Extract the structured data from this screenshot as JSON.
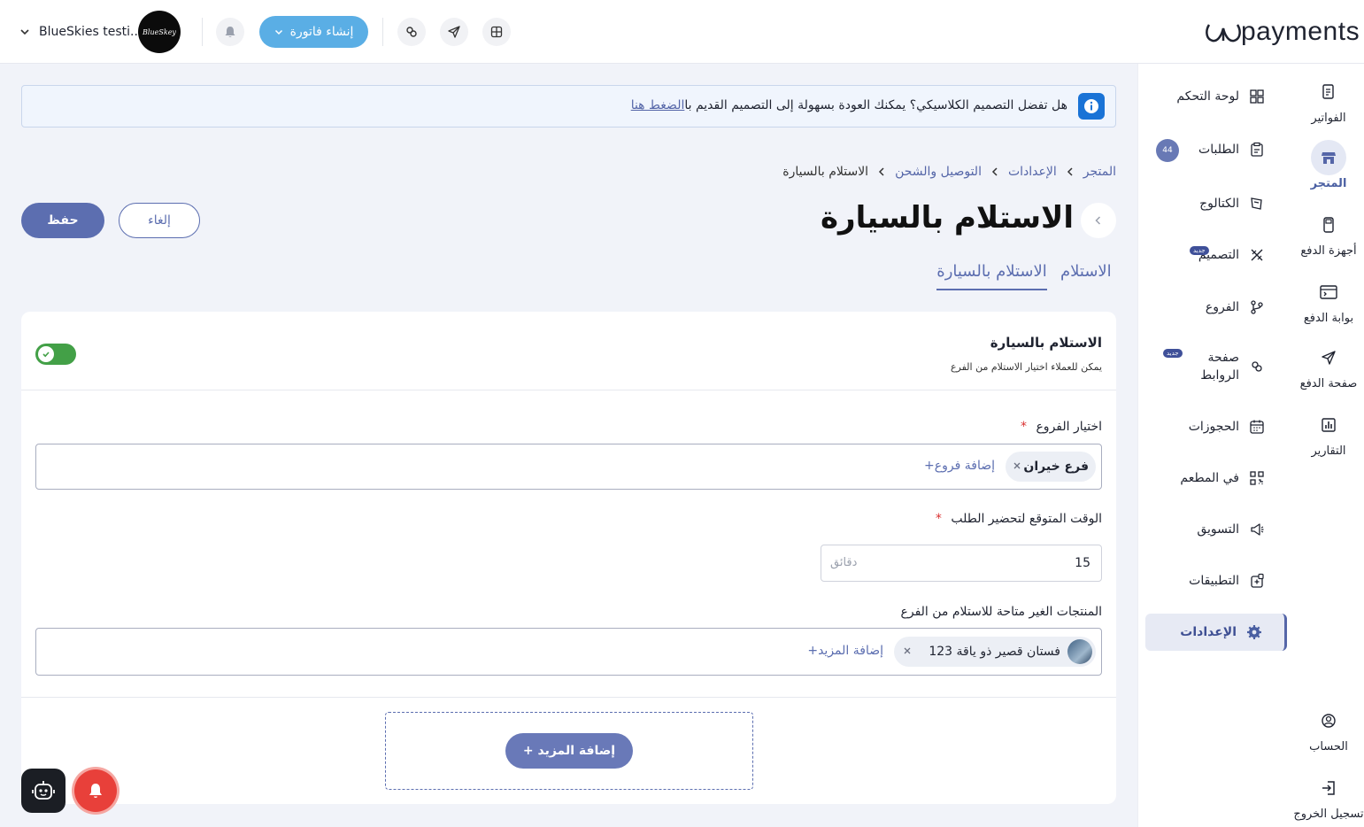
{
  "topbar": {
    "logo_text": "payments",
    "account_name": "BlueSkies testi...",
    "account_avatar_text": "BlueSkey",
    "create_invoice_label": "إنشاء فاتورة",
    "colors": {
      "primary": "#5c6eb0",
      "invoice_button": "#5aaee5"
    }
  },
  "iconbar": [
    {
      "label": "الفواتير",
      "icon": "invoice-icon"
    },
    {
      "label": "المتجر",
      "icon": "store-icon",
      "active": true
    },
    {
      "label": "أجهزة الدفع",
      "icon": "pos-device-icon"
    },
    {
      "label": "بوابة الدفع",
      "icon": "gateway-icon"
    },
    {
      "label": "صفحة الدفع",
      "icon": "send-icon"
    },
    {
      "label": "التقارير",
      "icon": "chart-icon"
    },
    {
      "label": "الحساب",
      "icon": "account-icon"
    },
    {
      "label": "تسجيل الخروج",
      "icon": "logout-icon"
    }
  ],
  "menu": {
    "items": [
      {
        "label": "لوحة التحكم",
        "icon": "dashboard-icon"
      },
      {
        "label": "الطلبات",
        "icon": "orders-icon",
        "count": "44"
      },
      {
        "label": "الكتالوج",
        "icon": "catalog-icon"
      },
      {
        "label": "التصميم",
        "icon": "design-icon",
        "badge": "جديد"
      },
      {
        "label": "الفروع",
        "icon": "branches-icon"
      },
      {
        "label": "صفحة الروابط",
        "icon": "link-icon",
        "badge": "جديد"
      },
      {
        "label": "الحجوزات",
        "icon": "calendar-icon"
      },
      {
        "label": "في المطعم",
        "icon": "qr-icon"
      },
      {
        "label": "التسويق",
        "icon": "megaphone-icon"
      },
      {
        "label": "التطبيقات",
        "icon": "apps-icon"
      },
      {
        "label": "الإعدادات",
        "icon": "settings-icon",
        "active": true
      }
    ]
  },
  "info_banner": {
    "text": "هل تفضل التصميم الكلاسيكي؟ يمكنك العودة بسهولة إلى التصميم القديم با",
    "link": "الضغط هنا"
  },
  "breadcrumb": [
    "المتجر",
    "الإعدادات",
    "التوصيل والشحن",
    "الاستلام بالسيارة"
  ],
  "page": {
    "title": "الاستلام بالسيارة",
    "save_label": "حفظ",
    "cancel_label": "إلغاء",
    "tabs": [
      {
        "label": "الاستلام",
        "active": false
      },
      {
        "label": "الاستلام بالسيارة",
        "active": true
      }
    ]
  },
  "section": {
    "title": "الاستلام بالسيارة",
    "subtitle": "يمكن للعملاء اختيار الاستلام من الفرع",
    "enabled": true
  },
  "branches": {
    "label": "اختيار الفروع",
    "required_mark": "*",
    "chip": "فرع خيران",
    "add_label": "+إضافة فروع"
  },
  "prep_time": {
    "label": "الوقت المتوقع لتحضير الطلب",
    "required_mark": "*",
    "value": "15",
    "unit": "دقائق"
  },
  "unavailable_products": {
    "label": "المنتجات الغير متاحة للاستلام من الفرع",
    "chip": "فستان قصير ذو ياقة 123",
    "add_label": "+إضافة المزيد"
  },
  "add_more_button": "+ إضافة المزيد"
}
